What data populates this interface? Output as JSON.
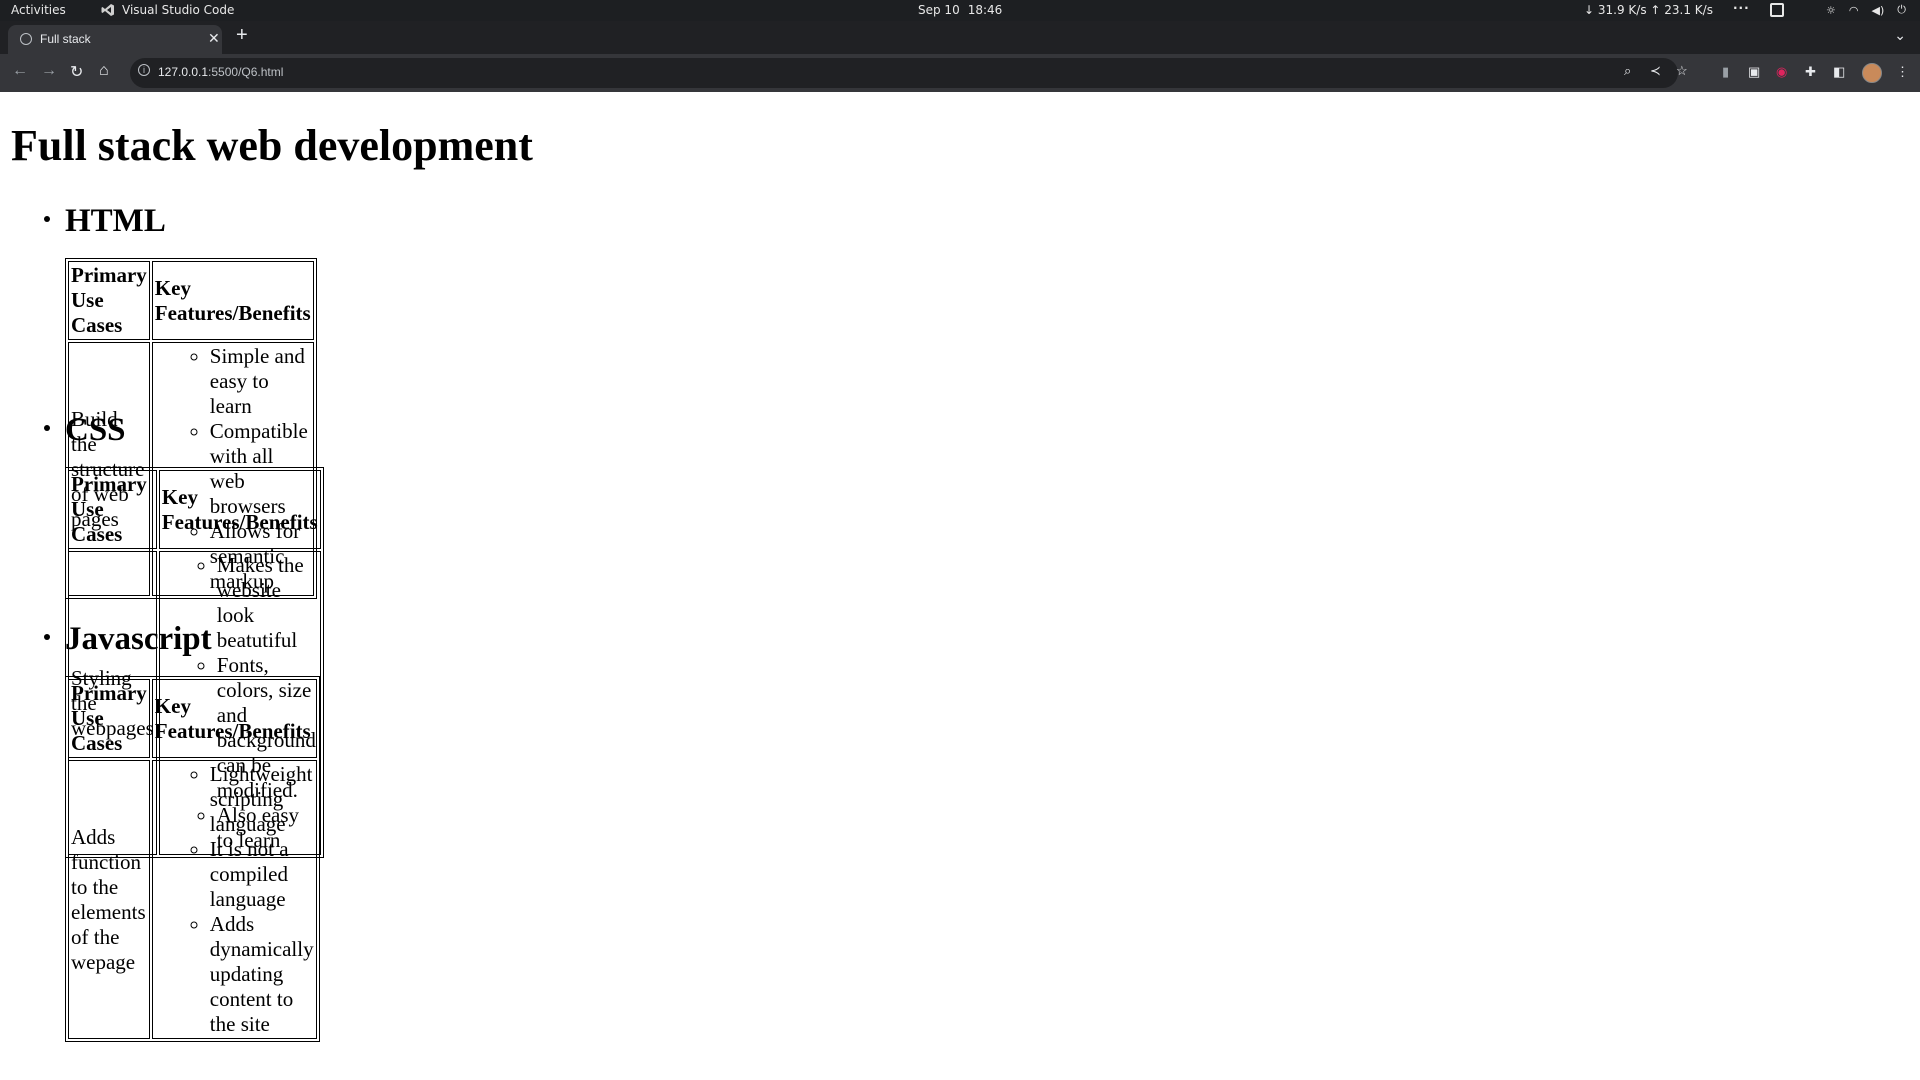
{
  "topbar": {
    "activities": "Activities",
    "app_name": "Visual Studio Code",
    "date": "Sep 10",
    "time": "18:46",
    "network": "↓ 31.9 K/s ↑ 23.1 K/s"
  },
  "browser": {
    "tab_title": "Full stack",
    "url_host": "127.0.0.1",
    "url_rest": ":5500/Q6.html"
  },
  "page": {
    "title": "Full stack web development",
    "column_headers": {
      "primary": "Primary Use Cases",
      "features": "Key Features/Benefits"
    },
    "sections": [
      {
        "heading": "HTML",
        "use_case": "Build the structure of web pages",
        "features": [
          "Simple and easy to learn",
          "Compatible with all web browsers",
          "Allows for semantic markup"
        ]
      },
      {
        "heading": "CSS",
        "use_case": "Styling the webpages",
        "features": [
          "Makes the website look beatutiful",
          "Fonts, colors, size and background can be modified.",
          "Also easy to learn"
        ]
      },
      {
        "heading": "Javascript",
        "use_case": "Adds function to the elements of the wepage",
        "features": [
          "Lightweight scripting language",
          "It is not a compiled language",
          "Adds dynamically updating content to the site"
        ]
      }
    ]
  }
}
